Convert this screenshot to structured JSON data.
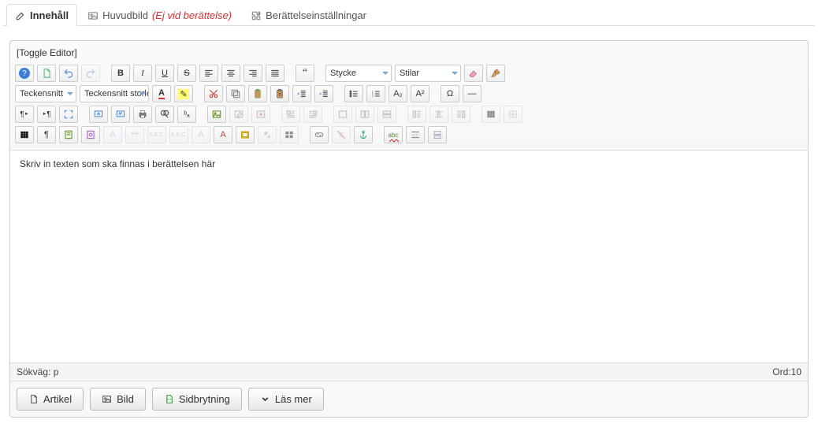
{
  "tabs": {
    "content": {
      "label": "Innehåll"
    },
    "mainimage": {
      "label": "Huvudbild",
      "suffix": "(Ej vid berättelse)"
    },
    "storysettings": {
      "label": "Berättelseinställningar"
    }
  },
  "toggle_editor": "[Toggle Editor]",
  "selects": {
    "format": "Stycke",
    "styles": "Stilar",
    "fontfamily": "Teckensnitt",
    "fontsize": "Teckensnitt storlek"
  },
  "glyphs": {
    "bold": "B",
    "italic": "I",
    "underline": "U",
    "strike": "S",
    "quote": "“",
    "textcolor": "A",
    "bgcolor": "✎",
    "sub": "A₂",
    "sup": "A²",
    "omega": "Ω",
    "hr": "―",
    "ltr": "¶‣",
    "rtl": "‣¶",
    "pilcrow": "¶",
    "ba": "ᵇₐ",
    "abc": "A.B.C.",
    "smalla": "A",
    "abc2": "A",
    "sixsix": "❝❝",
    "spellcheck": "abc"
  },
  "editor_text": "Skriv in texten som ska finnas i berättelsen här",
  "status": {
    "path_label": "Sökväg:",
    "path_value": "p",
    "words_label": "Ord:",
    "words_value": "10"
  },
  "actions": {
    "article": "Artikel",
    "image": "Bild",
    "pagebreak": "Sidbrytning",
    "readmore": "Läs mer"
  }
}
